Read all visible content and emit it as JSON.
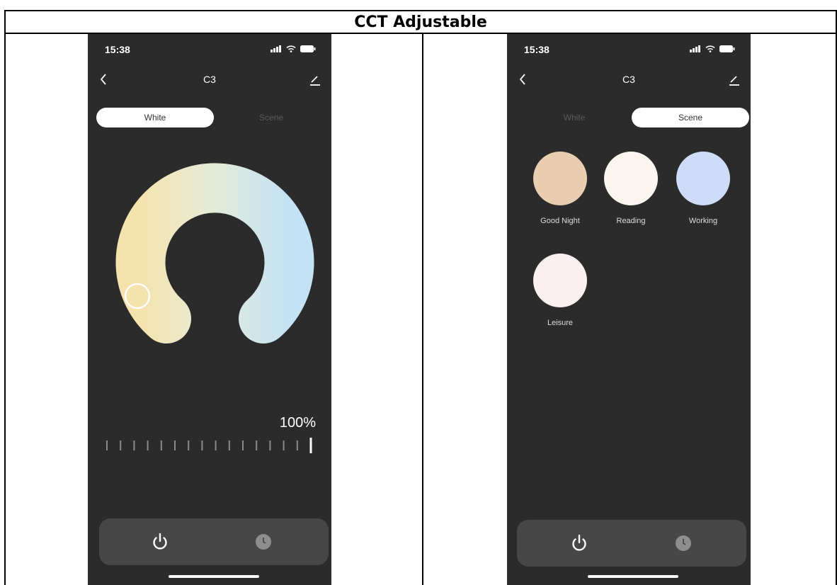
{
  "header": {
    "title": "CCT Adjustable"
  },
  "colors": {
    "background": "#2b2b2b",
    "bar": "#474747",
    "active_tab": "#ffffff"
  },
  "left_screen": {
    "status": {
      "time": "15:38"
    },
    "nav": {
      "title": "C3"
    },
    "tabs": [
      {
        "label": "White",
        "active": true
      },
      {
        "label": "Scene",
        "active": false
      }
    ],
    "brightness": {
      "label": "100%",
      "percent": 100
    },
    "icons": {
      "back": "chevron-left-icon",
      "edit": "edit-icon",
      "power": "power-icon",
      "timer": "clock-icon"
    }
  },
  "right_screen": {
    "status": {
      "time": "15:38"
    },
    "nav": {
      "title": "C3"
    },
    "tabs": [
      {
        "label": "White",
        "active": false
      },
      {
        "label": "Scene",
        "active": true
      }
    ],
    "scenes": [
      {
        "label": "Good Night",
        "color": "#e9cdb0"
      },
      {
        "label": "Reading",
        "color": "#faf5ee"
      },
      {
        "label": "Working",
        "color": "#cfdcf7"
      },
      {
        "label": "Leisure",
        "color": "#fbf0ef"
      }
    ]
  }
}
